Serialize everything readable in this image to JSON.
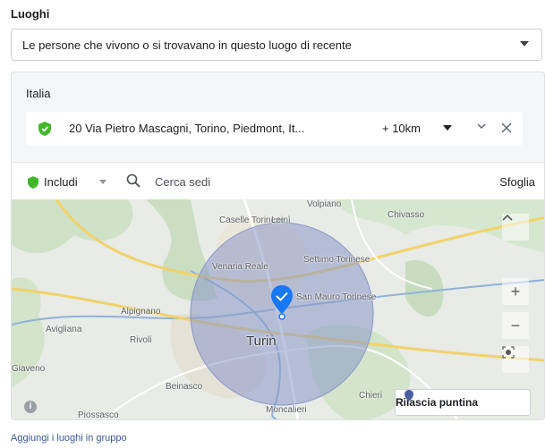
{
  "section_title": "Luoghi",
  "audience_select": {
    "value": "Le persone che vivono o si trovavano in questo luogo di recente"
  },
  "panel": {
    "country": "Italia",
    "location": {
      "text": "20 Via Pietro Mascagni, Torino, Piedmont, It...",
      "radius": "+ 10km"
    }
  },
  "toolbar": {
    "include_label": "Includi",
    "search_placeholder": "Cerca sedi",
    "browse_label": "Sfoglia"
  },
  "map": {
    "labels": {
      "caselle": "Caselle Torinese",
      "leini": "Leinì",
      "volpiano": "Volpiano",
      "chivasso": "Chivasso",
      "venaria": "Venaria Reale",
      "settimo": "Settimo Torinese",
      "san_mauro": "San Mauro Torinese",
      "alpignano": "Alpignano",
      "avigliana": "Avigliana",
      "rivoli": "Rivoli",
      "turin": "Turin",
      "giaveno": "Giaveno",
      "beinasco": "Beinasco",
      "moncalieri": "Moncalieri",
      "chieri": "Chieri",
      "piossasco": "Piossasco"
    },
    "zoom_in": "+",
    "zoom_out": "−",
    "drop_pin_label": "Rilascia puntina",
    "colors": {
      "radius_fill": "#8a97c8",
      "pin": "#1877f2",
      "include": "#42b72a"
    }
  },
  "footer_link": "Aggiungi i luoghi in gruppo"
}
